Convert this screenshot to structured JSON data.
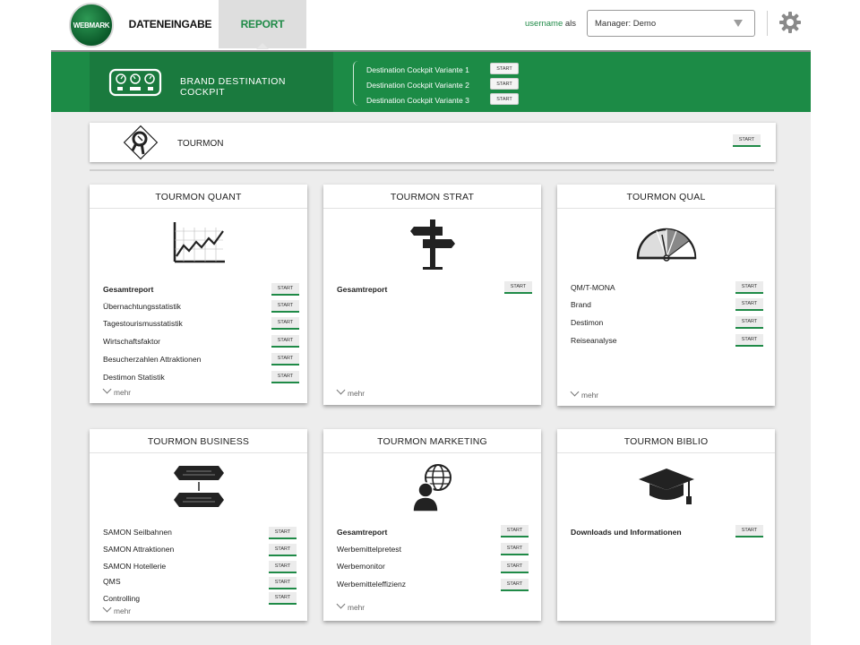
{
  "header": {
    "logo_text": "WEBMARK",
    "tabs": [
      {
        "label": "DATENEINGABE"
      },
      {
        "label": "REPORT"
      }
    ],
    "user_name": "username",
    "user_suffix": "als",
    "manager_select": "Manager: Demo"
  },
  "banner": {
    "title": "BRAND DESTINATION COCKPIT",
    "variants": [
      {
        "label": "Destination Cockpit Variante 1",
        "button": "START"
      },
      {
        "label": "Destination Cockpit Variante 2",
        "button": "START"
      },
      {
        "label": "Destination Cockpit Variante 3",
        "button": "START"
      }
    ]
  },
  "tourmon": {
    "title": "TOURMON",
    "button": "START"
  },
  "cards": {
    "quant": {
      "title": "TOURMON QUANT",
      "items": [
        {
          "label": "Gesamtreport",
          "button": "START"
        },
        {
          "label": "Übernachtungsstatistik",
          "button": "START"
        },
        {
          "label": "Tagestourismusstatistik",
          "button": "START"
        },
        {
          "label": "Wirtschaftsfaktor",
          "button": "START"
        },
        {
          "label": "Besucherzahlen Attraktionen",
          "button": "START"
        },
        {
          "label": "Destimon Statistik",
          "button": "START"
        }
      ],
      "more": "mehr"
    },
    "strat": {
      "title": "TOURMON STRAT",
      "items": [
        {
          "label": "Gesamtreport",
          "button": "START"
        }
      ],
      "more": "mehr"
    },
    "qual": {
      "title": "TOURMON QUAL",
      "items": [
        {
          "label": "QM/T-MONA",
          "button": "START"
        },
        {
          "label": "Brand",
          "button": "START"
        },
        {
          "label": "Destimon",
          "button": "START"
        },
        {
          "label": "Reiseanalyse",
          "button": "START"
        }
      ],
      "more": "mehr"
    },
    "business": {
      "title": "TOURMON BUSINESS",
      "items": [
        {
          "label": "SAMON Seilbahnen",
          "button": "START"
        },
        {
          "label": "SAMON Attraktionen",
          "button": "START"
        },
        {
          "label": "SAMON Hotellerie",
          "button": "START"
        },
        {
          "label": "QMS",
          "button": "START"
        },
        {
          "label": "Controlling",
          "button": "START"
        }
      ],
      "more": "mehr"
    },
    "marketing": {
      "title": "TOURMON MARKETING",
      "items": [
        {
          "label": "Gesamtreport",
          "button": "START"
        },
        {
          "label": "Werbemittelpretest",
          "button": "START"
        },
        {
          "label": "Werbemonitor",
          "button": "START"
        },
        {
          "label": "Werbemitteleffizienz",
          "button": "START"
        }
      ],
      "more": "mehr"
    },
    "biblio": {
      "title": "TOURMON BIBLIO",
      "items": [
        {
          "label": "Downloads und Informationen",
          "button": "START"
        }
      ]
    }
  },
  "icons": {
    "logo": "webmark-logo",
    "gear": "gear-icon",
    "cockpit": "dashboard-gauges-icon",
    "tourmon": "tourmon-diamond-icon",
    "quant": "line-chart-icon",
    "strat": "signpost-icon",
    "qual": "half-gauge-icon",
    "business": "signboards-icon",
    "marketing": "globe-person-icon",
    "biblio": "graduation-cap-icon"
  },
  "colors": {
    "accent_green": "#1c8b46",
    "banner_dark": "#1a7a3e",
    "report_tab_bg": "#dedede",
    "content_bg": "#ededed"
  }
}
